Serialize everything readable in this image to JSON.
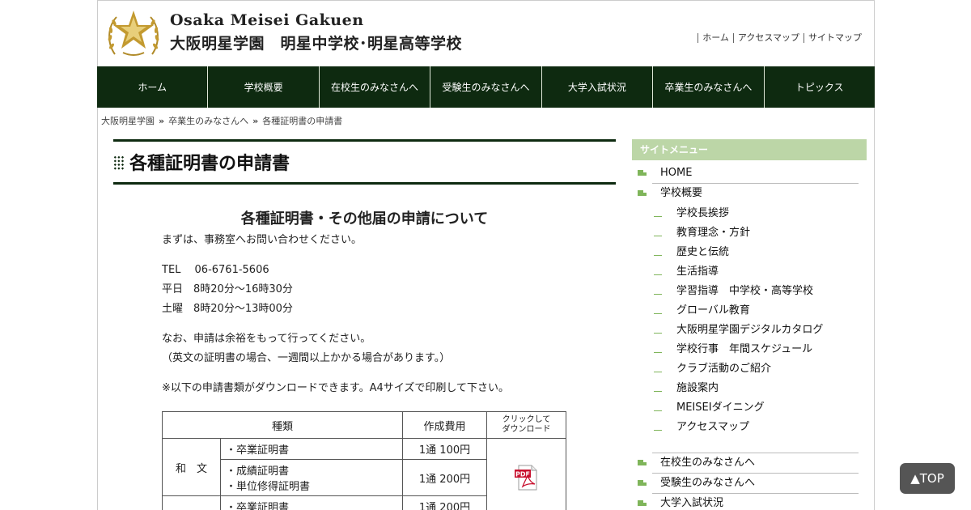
{
  "header": {
    "logo_en": "Osaka Meisei Gakuen",
    "logo_ja": "大阪明星学園　明星中学校･明星高等学校",
    "toplinks": [
      "ホーム",
      "アクセスマップ",
      "サイトマップ"
    ]
  },
  "nav": [
    "ホーム",
    "学校概要",
    "在校生のみなさんへ",
    "受験生のみなさんへ",
    "大学入試状況",
    "卒業生のみなさんへ",
    "トピックス"
  ],
  "breadcrumb": [
    "大阪明星学園",
    "卒業生のみなさんへ",
    "各種証明書の申請書"
  ],
  "breadcrumb_sep": "»",
  "page_title": "各種証明書の申請書",
  "content": {
    "heading": "各種証明書・その他届の申請について",
    "line1": "まずは、事務室へお問い合わせください。",
    "tel": "TEL　 06-6761-5606",
    "weekday": "平日　8時20分～16時30分",
    "saturday": "土曜　8時20分～13時00分",
    "note1": "なお、申請は余裕をもって行ってください。",
    "note2": "（英文の証明書の場合、一週間以上かかる場合があります。）",
    "note3": "※以下の申請書類がダウンロードできます。A4サイズで印刷して下さい。"
  },
  "table": {
    "col_type": "種類",
    "col_fee": "作成費用",
    "col_dl_1": "クリックして",
    "col_dl_2": "ダウンロード",
    "group_wabun": "和　文",
    "rows": [
      {
        "name": "・卒業証明書",
        "fee": "1通 100円"
      },
      {
        "name1": "・成績証明書",
        "name2": "・単位修得証明書",
        "fee": "1通 200円"
      },
      {
        "name": "・卒業証明書",
        "fee": "1通 200円"
      }
    ],
    "pdf_label": "PDF"
  },
  "sidebar": {
    "title": "サイトメニュー",
    "home": "HOME",
    "overview": "学校概要",
    "children": [
      "学校長挨拶",
      "教育理念・方針",
      "歴史と伝統",
      "生活指導",
      "学習指導　中学校・高等学校",
      "グローバル教育",
      "大阪明星学園デジタルカタログ",
      "学校行事　年間スケジュール",
      "クラブ活動のご紹介",
      "施設案内",
      "MEISEIダイニング",
      "アクセスマップ"
    ],
    "after": [
      "在校生のみなさんへ",
      "受験生のみなさんへ",
      "大学入試状況"
    ]
  },
  "top_button": "▲TOP",
  "colors": {
    "nav_bg": "#0e2a10",
    "side_head": "#bcd6a7",
    "accent_green": "#7fb55a"
  }
}
